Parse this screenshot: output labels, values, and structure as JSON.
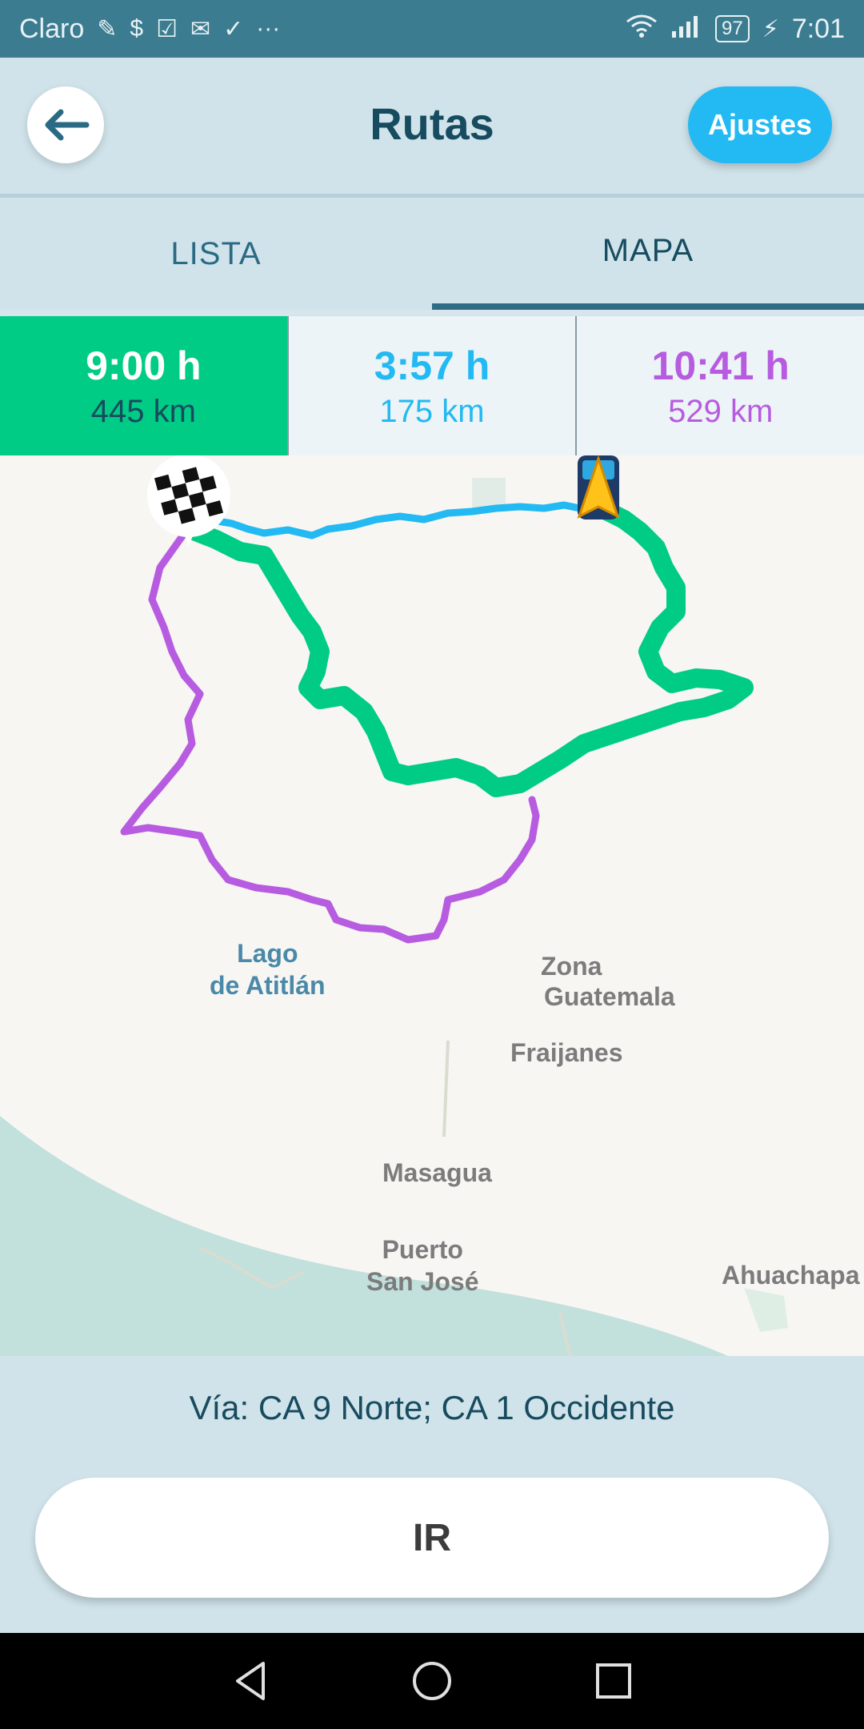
{
  "status": {
    "carrier": "Claro",
    "battery": "97",
    "time": "7:01",
    "icons": [
      "app-notification-icon",
      "dollar-icon",
      "check-icon",
      "mail-icon",
      "download-check-icon",
      "more-icon",
      "wifi-icon",
      "signal-icon",
      "battery-icon",
      "charging-icon"
    ]
  },
  "header": {
    "title": "Rutas",
    "settings_label": "Ajustes"
  },
  "tabs": [
    {
      "label": "LISTA"
    },
    {
      "label": "MAPA",
      "active": true
    }
  ],
  "routes": [
    {
      "time": "9:00 h",
      "distance": "445 km",
      "color": "#00cc85",
      "selected": true
    },
    {
      "time": "3:57 h",
      "distance": "175 km",
      "color": "#23b9f2"
    },
    {
      "time": "10:41 h",
      "distance": "529 km",
      "color": "#b75ce0"
    }
  ],
  "map": {
    "labels": {
      "lake": "Lago\nde Atitlán",
      "zona": "Zona",
      "guatemala": "Guatemala",
      "fraijanes": "Fraijanes",
      "masagua": "Masagua",
      "puerto": "Puerto\nSan José",
      "ahuachapan": "Ahuachapa"
    }
  },
  "via": "Vía: CA 9 Norte; CA 1 Occidente",
  "go_label": "IR",
  "colors": {
    "accent_green": "#00cc85",
    "accent_blue": "#23b9f2",
    "accent_purple": "#b75ce0",
    "header_bg": "#3c7c90"
  }
}
